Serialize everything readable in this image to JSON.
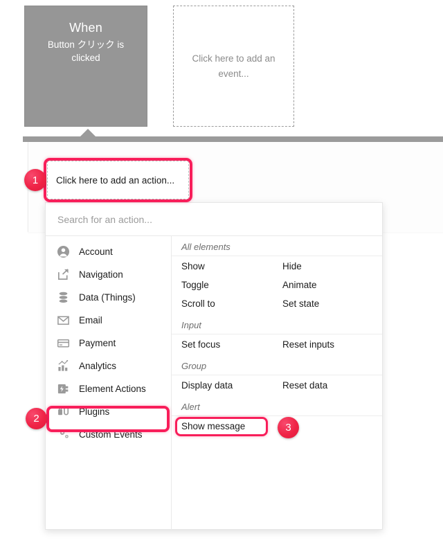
{
  "event_row": {
    "when_title": "When",
    "when_subtitle": "Button クリック is clicked",
    "add_event_placeholder": "Click here to add an event..."
  },
  "workflow": {
    "add_action_placeholder": "Click here to add an action..."
  },
  "dropdown": {
    "search_placeholder": "Search for an action...",
    "categories": [
      {
        "label": "Account",
        "icon": "account-icon"
      },
      {
        "label": "Navigation",
        "icon": "navigation-icon"
      },
      {
        "label": "Data (Things)",
        "icon": "database-icon"
      },
      {
        "label": "Email",
        "icon": "email-icon"
      },
      {
        "label": "Payment",
        "icon": "payment-card-icon"
      },
      {
        "label": "Analytics",
        "icon": "analytics-icon"
      },
      {
        "label": "Element Actions",
        "icon": "element-actions-icon"
      },
      {
        "label": "Plugins",
        "icon": "plugins-icon"
      },
      {
        "label": "Custom Events",
        "icon": "custom-events-icon"
      }
    ],
    "groups": [
      {
        "header": "All elements",
        "rows": [
          [
            "Show",
            "Hide"
          ],
          [
            "Toggle",
            "Animate"
          ],
          [
            "Scroll to",
            "Set state"
          ]
        ]
      },
      {
        "header": "Input",
        "rows": [
          [
            "Set focus",
            "Reset inputs"
          ]
        ]
      },
      {
        "header": "Group",
        "rows": [
          [
            "Display data",
            "Reset data"
          ]
        ]
      },
      {
        "header": "Alert",
        "rows": [
          [
            "Show message",
            ""
          ]
        ]
      }
    ]
  },
  "annotations": {
    "badge1": "1",
    "badge2": "2",
    "badge3": "3",
    "highlight_color": "#f81e5a",
    "badge_color": "#ef2346"
  }
}
